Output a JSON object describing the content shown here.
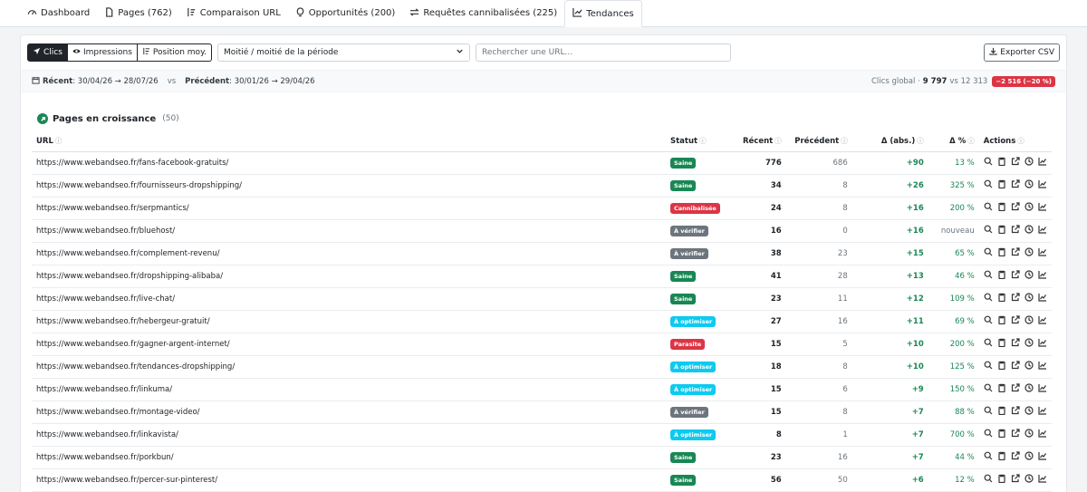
{
  "tabs": [
    {
      "label": "Dashboard",
      "icon": "speedometer-icon",
      "active": false
    },
    {
      "label": "Pages (762)",
      "icon": "file-icon",
      "active": false
    },
    {
      "label": "Comparaison URL",
      "icon": "sort-icon",
      "active": false
    },
    {
      "label": "Opportunités (200)",
      "icon": "lightbulb-icon",
      "active": false
    },
    {
      "label": "Requêtes cannibalisées (225)",
      "icon": "swap-icon",
      "active": false
    },
    {
      "label": "Tendances",
      "icon": "trend-icon",
      "active": true
    }
  ],
  "toolbar": {
    "metrics": [
      {
        "label": "Clics",
        "icon": "cursor-icon",
        "active": true
      },
      {
        "label": "Impressions",
        "icon": "eye-icon",
        "active": false
      },
      {
        "label": "Position moy.",
        "icon": "sort-icon",
        "active": false
      }
    ],
    "period_select": "Moitié / moitié de la période",
    "search_placeholder": "Rechercher une URL...",
    "export_label": "Exporter CSV"
  },
  "period": {
    "recent_label": "Récent",
    "recent_range": ": 30/04/26 → 28/07/26",
    "vs": "vs",
    "previous_label": "Précédent",
    "previous_range": ": 30/01/26 → 29/04/26",
    "global_label": "Clics global ·",
    "global_recent": "9 797",
    "global_vs": "vs 12 313",
    "global_delta": "−2 516 (−20 %)"
  },
  "section": {
    "title": "Pages en croissance",
    "count": "(50)"
  },
  "columns": {
    "url": "URL",
    "statut": "Statut",
    "recent": "Récent",
    "precedent": "Précédent",
    "dabs": "Δ (abs.)",
    "dpct": "Δ %",
    "actions": "Actions",
    "info": "ⓘ"
  },
  "colors": {
    "Saine": "#198754",
    "Cannibalisée": "#dc3545",
    "À vérifier": "#6c757d",
    "À optimiser": "#0dcaf0",
    "Parasite": "#dc3545"
  },
  "rows": [
    {
      "url": "https://www.webandseo.fr/fans-facebook-gratuits/",
      "statut": "Saine",
      "recent": "776",
      "precedent": "686",
      "dabs": "+90",
      "dpct": "13 %"
    },
    {
      "url": "https://www.webandseo.fr/fournisseurs-dropshipping/",
      "statut": "Saine",
      "recent": "34",
      "precedent": "8",
      "dabs": "+26",
      "dpct": "325 %"
    },
    {
      "url": "https://www.webandseo.fr/serpmantics/",
      "statut": "Cannibalisée",
      "recent": "24",
      "precedent": "8",
      "dabs": "+16",
      "dpct": "200 %"
    },
    {
      "url": "https://www.webandseo.fr/bluehost/",
      "statut": "À vérifier",
      "recent": "16",
      "precedent": "0",
      "dabs": "+16",
      "dpct": "nouveau"
    },
    {
      "url": "https://www.webandseo.fr/complement-revenu/",
      "statut": "À vérifier",
      "recent": "38",
      "precedent": "23",
      "dabs": "+15",
      "dpct": "65 %"
    },
    {
      "url": "https://www.webandseo.fr/dropshipping-alibaba/",
      "statut": "Saine",
      "recent": "41",
      "precedent": "28",
      "dabs": "+13",
      "dpct": "46 %"
    },
    {
      "url": "https://www.webandseo.fr/live-chat/",
      "statut": "Saine",
      "recent": "23",
      "precedent": "11",
      "dabs": "+12",
      "dpct": "109 %"
    },
    {
      "url": "https://www.webandseo.fr/hebergeur-gratuit/",
      "statut": "À optimiser",
      "recent": "27",
      "precedent": "16",
      "dabs": "+11",
      "dpct": "69 %"
    },
    {
      "url": "https://www.webandseo.fr/gagner-argent-internet/",
      "statut": "Parasite",
      "recent": "15",
      "precedent": "5",
      "dabs": "+10",
      "dpct": "200 %"
    },
    {
      "url": "https://www.webandseo.fr/tendances-dropshipping/",
      "statut": "À optimiser",
      "recent": "18",
      "precedent": "8",
      "dabs": "+10",
      "dpct": "125 %"
    },
    {
      "url": "https://www.webandseo.fr/linkuma/",
      "statut": "À optimiser",
      "recent": "15",
      "precedent": "6",
      "dabs": "+9",
      "dpct": "150 %"
    },
    {
      "url": "https://www.webandseo.fr/montage-video/",
      "statut": "À vérifier",
      "recent": "15",
      "precedent": "8",
      "dabs": "+7",
      "dpct": "88 %"
    },
    {
      "url": "https://www.webandseo.fr/linkavista/",
      "statut": "À optimiser",
      "recent": "8",
      "precedent": "1",
      "dabs": "+7",
      "dpct": "700 %"
    },
    {
      "url": "https://www.webandseo.fr/porkbun/",
      "statut": "Saine",
      "recent": "23",
      "precedent": "16",
      "dabs": "+7",
      "dpct": "44 %"
    },
    {
      "url": "https://www.webandseo.fr/percer-sur-pinterest/",
      "statut": "Saine",
      "recent": "56",
      "precedent": "50",
      "dabs": "+6",
      "dpct": "12 %"
    }
  ]
}
